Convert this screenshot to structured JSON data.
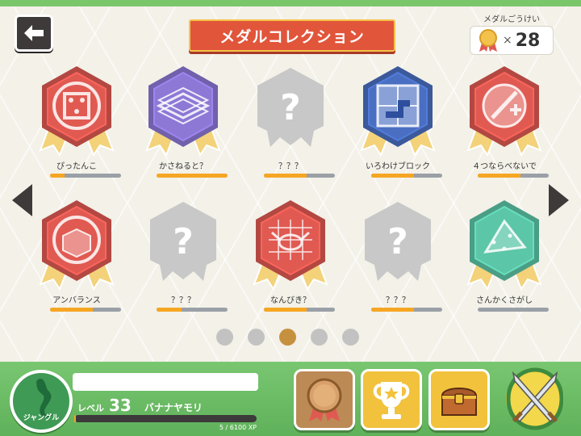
{
  "header": {
    "title": "メダルコレクション",
    "total_label": "メダルごうけい",
    "total_times": "×",
    "total_count": "28"
  },
  "medals": [
    {
      "name": "ぴったんこ",
      "progress": 0.2,
      "color": "#e05a52",
      "icon": "square-dots-icon"
    },
    {
      "name": "かさねると？",
      "progress": 1.0,
      "color": "#8d78d6",
      "icon": "stacked-layers-icon"
    },
    {
      "name": "？？？",
      "progress": 0.6,
      "color": "#c8c8c8",
      "icon": "question-icon"
    },
    {
      "name": "いろわけブロック",
      "progress": 0.6,
      "color": "#4a6fc2",
      "icon": "grid-blocks-icon"
    },
    {
      "name": "４つならべないで",
      "progress": 0.6,
      "color": "#e05a52",
      "icon": "four-plus-icon"
    },
    {
      "name": "アンバランス",
      "progress": 0.6,
      "color": "#e05a52",
      "icon": "cube-icon"
    },
    {
      "name": "？？？",
      "progress": 0.35,
      "color": "#c8c8c8",
      "icon": "question-icon"
    },
    {
      "name": "なんびき？",
      "progress": 0.6,
      "color": "#e05a52",
      "icon": "crab-icon"
    },
    {
      "name": "？？？",
      "progress": 0.6,
      "color": "#c8c8c8",
      "icon": "question-icon"
    },
    {
      "name": "さんかくさがし",
      "progress": 0.0,
      "color": "#5cc6a8",
      "icon": "triangle-icon"
    }
  ],
  "pagination": {
    "count": 5,
    "active": 3
  },
  "player": {
    "avatar_label": "ジャングル",
    "level_label": "レベル",
    "level": "33",
    "title": "バナナヤモリ",
    "xp_text": "5 / 6100 XP",
    "xp_progress": 0.001
  },
  "toolbar": {
    "medal_icon": "medal-icon",
    "trophy_icon": "trophy-icon",
    "chest_icon": "treasure-chest-icon",
    "battle_icon": "crossed-swords-icon"
  },
  "colors": {
    "accent": "#e1553b",
    "progress": "#f6a623",
    "dot_active": "#c6913f"
  }
}
